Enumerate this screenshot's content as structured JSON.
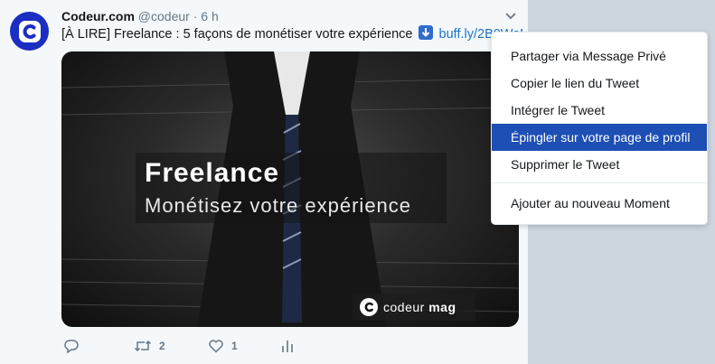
{
  "tweet": {
    "author_name": "Codeur.com",
    "author_handle": "@codeur",
    "separator": "·",
    "time": "6 h",
    "text": "[À LIRE] Freelance : 5 façons de monétiser votre expérience",
    "link": "buff.ly/2B0WoE...",
    "media": {
      "title": "Freelance",
      "subtitle": "Monétisez votre expérience",
      "brand_main": "codeur",
      "brand_suffix": "mag"
    },
    "actions": {
      "reply_icon": "reply-icon",
      "retweet_count": "2",
      "like_count": "1",
      "analytics_icon": "analytics-icon"
    }
  },
  "menu": {
    "items": [
      {
        "label": "Partager via Message Privé",
        "active": false
      },
      {
        "label": "Copier le lien du Tweet",
        "active": false
      },
      {
        "label": "Intégrer le Tweet",
        "active": false
      },
      {
        "label": "Épingler sur votre page de profil",
        "active": true
      },
      {
        "label": "Supprimer le Tweet",
        "active": false
      },
      {
        "label": "Ajouter au nouveau Moment",
        "active": false
      }
    ]
  },
  "colors": {
    "brand_blue": "#1a2ec2",
    "menu_highlight": "#1d4fb5",
    "link": "#1b74c6"
  }
}
